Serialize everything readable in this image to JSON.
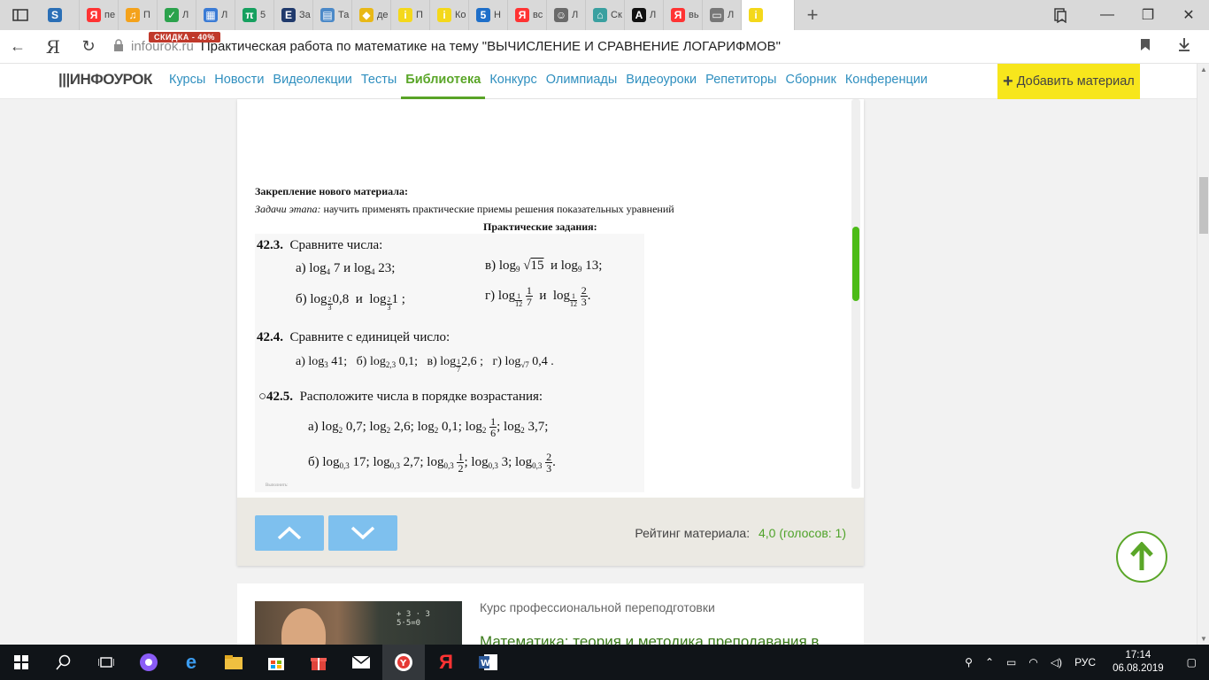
{
  "browser": {
    "tabs": [
      {
        "label": "",
        "fav": "S",
        "color": "#2b6fb6"
      },
      {
        "label": "пе",
        "fav": "Я",
        "color": "#ff3333"
      },
      {
        "label": "П",
        "fav": "♫",
        "color": "#f4a21b"
      },
      {
        "label": "Л",
        "fav": "✓",
        "color": "#2ba24c"
      },
      {
        "label": "Л",
        "fav": "▦",
        "color": "#3a7bd5"
      },
      {
        "label": "5",
        "fav": "π",
        "color": "#16a05f"
      },
      {
        "label": "За",
        "fav": "Е",
        "color": "#203a6c"
      },
      {
        "label": "Та",
        "fav": "▤",
        "color": "#4b89c8"
      },
      {
        "label": "де",
        "fav": "◆",
        "color": "#e8b817"
      },
      {
        "label": "П",
        "fav": "i",
        "color": "#f4d81b"
      },
      {
        "label": "Ко",
        "fav": "i",
        "color": "#f4d81b"
      },
      {
        "label": "Н",
        "fav": "5",
        "color": "#1f6fc9"
      },
      {
        "label": "вс",
        "fav": "Я",
        "color": "#ff3333"
      },
      {
        "label": "Л",
        "fav": "☺",
        "color": "#6a6a6a"
      },
      {
        "label": "Ск",
        "fav": "⌂",
        "color": "#3aa0a0"
      },
      {
        "label": "Л",
        "fav": "A",
        "color": "#111111"
      },
      {
        "label": "вь",
        "fav": "Я",
        "color": "#ff3333"
      },
      {
        "label": "Л",
        "fav": "▭",
        "color": "#777777"
      },
      {
        "label": "",
        "fav": "i",
        "color": "#f4d81b"
      }
    ],
    "new_tab": "+",
    "address": {
      "domain": "infourok.ru",
      "title": "Практическая работа по математике на тему \"ВЫЧИСЛЕНИЕ И СРАВНЕНИЕ ЛОГАРИФМОВ\""
    }
  },
  "site": {
    "logo": "ИНФОУРОК",
    "sale": "СКИДКА - 40%",
    "menu": [
      "Курсы",
      "Новости",
      "Видеолекции",
      "Тесты",
      "Библиотека",
      "Конкурс",
      "Олимпиады",
      "Видеоуроки",
      "Репетиторы",
      "Сборник",
      "Конференции"
    ],
    "active_menu": "Библиотека",
    "add_material": "Добавить материал"
  },
  "doc": {
    "heading1": "Закрепление нового материала:",
    "heading2_label": "Задачи этапа:",
    "heading2_text": " научить применять практические приемы решения показательных уравнений",
    "heading3": "Практические задания:",
    "p423_num": "42.3.",
    "p423_title": "Сравните числа:",
    "p424_num": "42.4.",
    "p424_title": "Сравните с единицей число:",
    "p425_num": "○42.5.",
    "p425_title": "Расположите числа в порядке возрастания:",
    "footer_tiny": "Выполнить:"
  },
  "viewer": {
    "rating_label": "Рейтинг материала:",
    "rating_value": "4,0 (голосов: 1)"
  },
  "course": {
    "type": "Курс профессиональной переподготовки",
    "title": "Математика: теория и методика преподавания в"
  },
  "taskbar": {
    "lang": "РУС",
    "time": "17:14",
    "date": "06.08.2019"
  }
}
